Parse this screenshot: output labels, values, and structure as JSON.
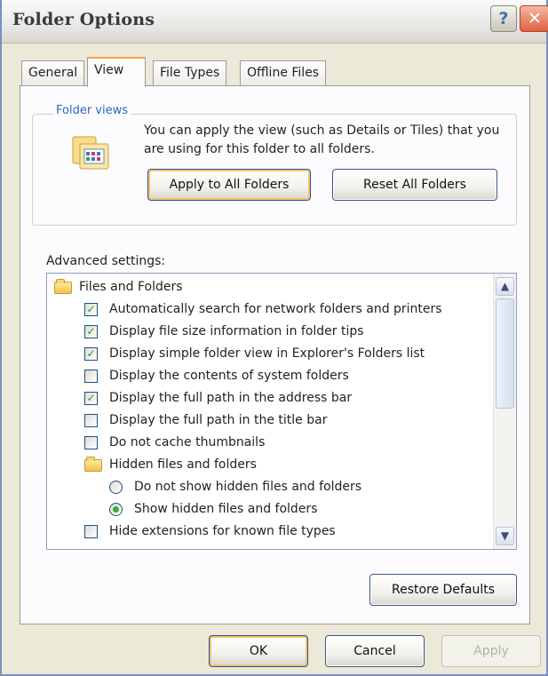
{
  "window": {
    "title": "Folder Options"
  },
  "tabs": [
    {
      "label": "General",
      "active": false
    },
    {
      "label": "View",
      "active": true
    },
    {
      "label": "File Types",
      "active": false
    },
    {
      "label": "Offline Files",
      "active": false
    }
  ],
  "folder_views": {
    "legend": "Folder views",
    "description": "You can apply the view (such as Details or Tiles) that you are using for this folder to all folders.",
    "apply_all_label": "Apply to All Folders",
    "reset_all_label": "Reset All Folders"
  },
  "advanced": {
    "label": "Advanced settings:",
    "items": [
      {
        "type": "folder",
        "label": "Files and Folders"
      },
      {
        "type": "checkbox",
        "label": "Automatically search for network folders and printers",
        "checked": true
      },
      {
        "type": "checkbox",
        "label": "Display file size information in folder tips",
        "checked": true
      },
      {
        "type": "checkbox",
        "label": "Display simple folder view in Explorer's Folders list",
        "checked": true
      },
      {
        "type": "checkbox",
        "label": "Display the contents of system folders",
        "checked": false
      },
      {
        "type": "checkbox",
        "label": "Display the full path in the address bar",
        "checked": true
      },
      {
        "type": "checkbox",
        "label": "Display the full path in the title bar",
        "checked": false
      },
      {
        "type": "checkbox",
        "label": "Do not cache thumbnails",
        "checked": false
      },
      {
        "type": "subfolder",
        "label": "Hidden files and folders"
      },
      {
        "type": "radio",
        "label": "Do not show hidden files and folders",
        "checked": false
      },
      {
        "type": "radio",
        "label": "Show hidden files and folders",
        "checked": true
      },
      {
        "type": "checkbox",
        "label": "Hide extensions for known file types",
        "checked": false
      }
    ],
    "restore_label": "Restore Defaults"
  },
  "footer": {
    "ok_label": "OK",
    "cancel_label": "Cancel",
    "apply_label": "Apply"
  },
  "colors": {
    "accent_tab": "#f1a44a",
    "check_green": "#21a121",
    "legend_blue": "#2f64c2"
  }
}
